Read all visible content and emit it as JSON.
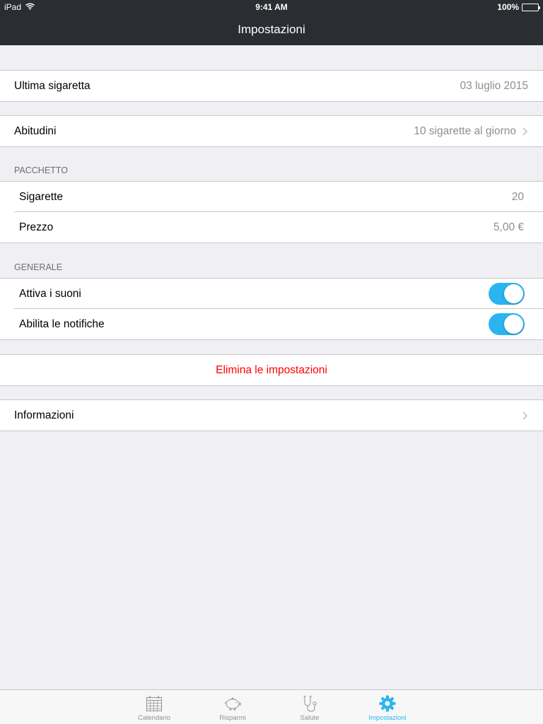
{
  "status_bar": {
    "device": "iPad",
    "time": "9:41 AM",
    "battery": "100%"
  },
  "nav": {
    "title": "Impostazioni"
  },
  "last_cigarette": {
    "label": "Ultima sigaretta",
    "value": "03 luglio 2015"
  },
  "habits": {
    "label": "Abitudini",
    "value": "10 sigarette al giorno"
  },
  "pack": {
    "header": "PACCHETTO",
    "cigarettes_label": "Sigarette",
    "cigarettes_value": "20",
    "price_label": "Prezzo",
    "price_value": "5,00 €"
  },
  "general": {
    "header": "GENERALE",
    "sounds_label": "Attiva i suoni",
    "sounds_on": true,
    "notifications_label": "Abilita le notifiche",
    "notifications_on": true
  },
  "reset": {
    "label": "Elimina le impostazioni"
  },
  "info": {
    "label": "Informazioni"
  },
  "tabs": [
    {
      "label": "Calendario",
      "icon": "calendar-icon",
      "active": false
    },
    {
      "label": "Risparmi",
      "icon": "piggy-bank-icon",
      "active": false
    },
    {
      "label": "Salute",
      "icon": "stethoscope-icon",
      "active": false
    },
    {
      "label": "Impostazioni",
      "icon": "gear-icon",
      "active": true
    }
  ],
  "colors": {
    "navbar": "#2a2d31",
    "accent": "#2ab5f0",
    "destructive": "#ff0000",
    "background": "#efeff4"
  }
}
